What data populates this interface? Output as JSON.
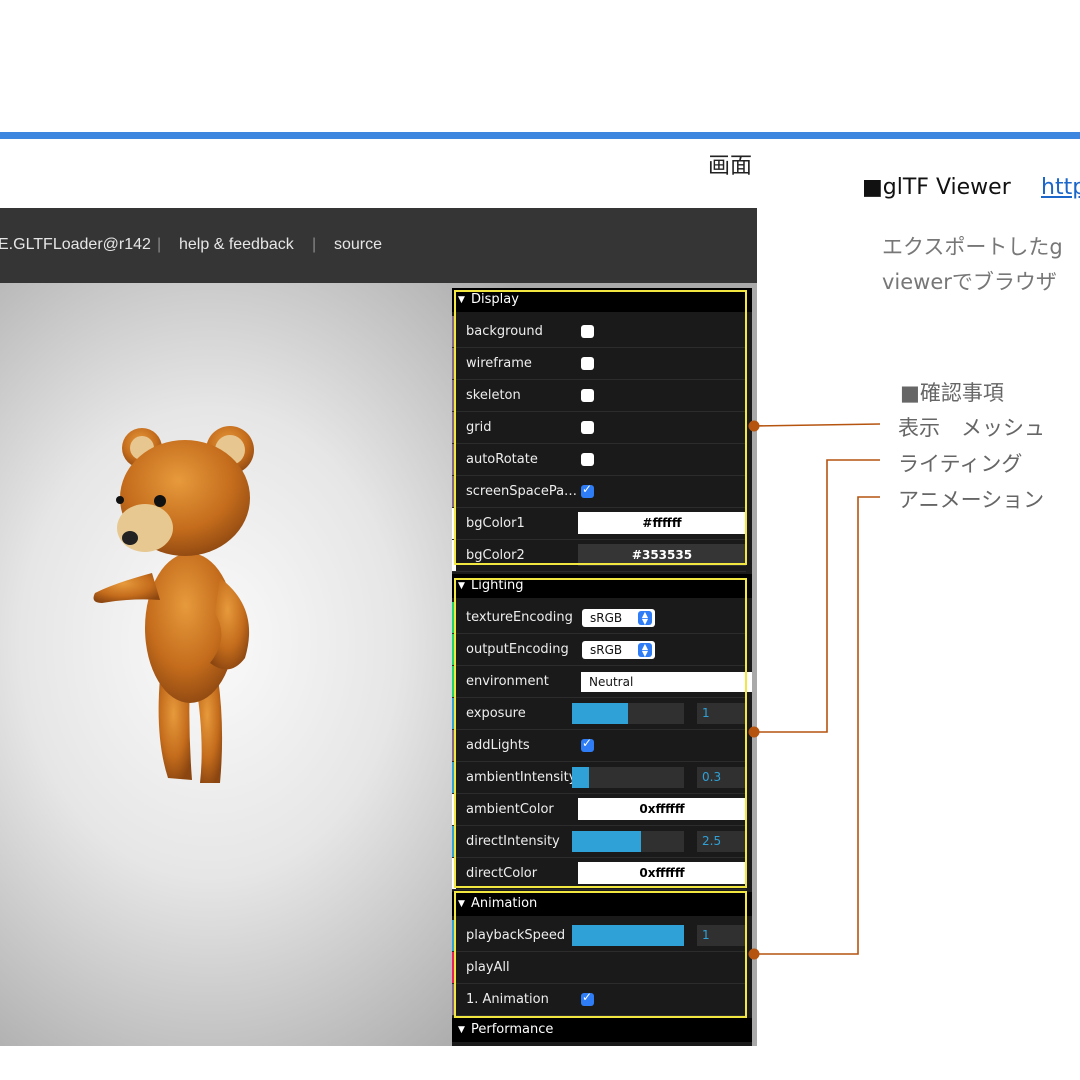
{
  "screen_label": "画面",
  "header": {
    "loader": "E.GLTFLoader@r142",
    "help": "help & feedback",
    "source": "source"
  },
  "gui": {
    "display": {
      "title": "Display",
      "rows": [
        {
          "label": "background",
          "checked": false
        },
        {
          "label": "wireframe",
          "checked": false
        },
        {
          "label": "skeleton",
          "checked": false
        },
        {
          "label": "grid",
          "checked": false
        },
        {
          "label": "autoRotate",
          "checked": false
        },
        {
          "label": "screenSpacePa…",
          "checked": true
        }
      ],
      "bgColor1": {
        "label": "bgColor1",
        "value": "#ffffff"
      },
      "bgColor2": {
        "label": "bgColor2",
        "value": "#353535"
      }
    },
    "lighting": {
      "title": "Lighting",
      "textureEncoding": {
        "label": "textureEncoding",
        "value": "sRGB"
      },
      "outputEncoding": {
        "label": "outputEncoding",
        "value": "sRGB"
      },
      "environment": {
        "label": "environment",
        "value": "Neutral"
      },
      "exposure": {
        "label": "exposure",
        "value": "1",
        "fill": 0.5
      },
      "addLights": {
        "label": "addLights",
        "checked": true
      },
      "ambientIntensity": {
        "label": "ambientIntensity",
        "value": "0.3",
        "fill": 0.15
      },
      "ambientColor": {
        "label": "ambientColor",
        "value": "0xffffff"
      },
      "directIntensity": {
        "label": "directIntensity",
        "value": "2.5",
        "fill": 0.62
      },
      "directColor": {
        "label": "directColor",
        "value": "0xffffff"
      }
    },
    "animation": {
      "title": "Animation",
      "playbackSpeed": {
        "label": "playbackSpeed",
        "value": "1",
        "fill": 1.0
      },
      "playAll": {
        "label": "playAll"
      },
      "anim1": {
        "label": "1. Animation",
        "checked": true
      }
    },
    "performance": {
      "title": "Performance"
    }
  },
  "side": {
    "viewer_title": "■glTF Viewer",
    "viewer_link": "http",
    "desc_line1": "エクスポートしたg",
    "desc_line2": "viewerでブラウザ",
    "check_title": "■確認事項",
    "check_items": [
      "表示　メッシュ",
      "ライティング",
      "アニメーション"
    ]
  },
  "colors": {
    "accent_bar": "#3d86e0",
    "highlight": "#f2e640",
    "connector": "#b5540f",
    "slider": "#2fa1d6",
    "link": "#1a66c9"
  }
}
